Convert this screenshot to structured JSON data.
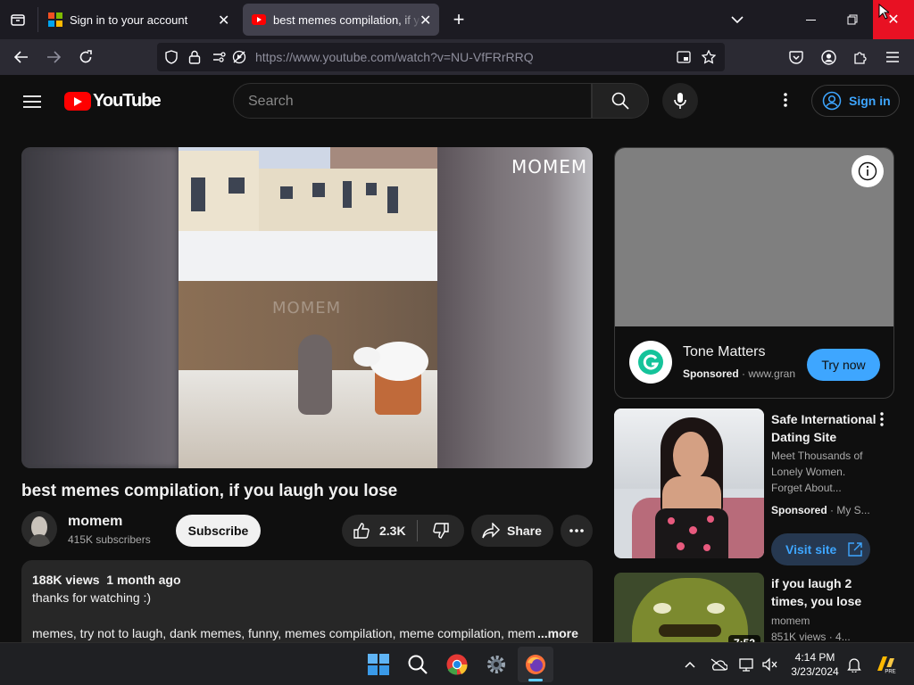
{
  "browser": {
    "tabs": [
      {
        "title": "Sign in to your account",
        "active": false
      },
      {
        "title": "best memes compilation, if you laugh you lose",
        "active": true
      }
    ],
    "url": "https://www.youtube.com/watch?v=NU-VfFRrRRQ"
  },
  "youtube": {
    "logo_text": "YouTube",
    "search_placeholder": "Search",
    "sign_in_label": "Sign in",
    "video": {
      "watermark": "MOMEM",
      "title": "best memes compilation, if you laugh you lose",
      "channel": "momem",
      "subscribers": "415K subscribers",
      "subscribe_label": "Subscribe",
      "likes": "2.3K",
      "share_label": "Share"
    },
    "description": {
      "views": "188K views",
      "age": "1 month ago",
      "line1": "thanks for watching :)",
      "tags": "memes, try not to laugh, dank memes, funny, memes compilation, meme compilation, mem",
      "more_label": "...more"
    },
    "ad_card": {
      "advertiser": "Tone Matters",
      "sponsored": "Sponsored",
      "domain": "www.gran",
      "cta": "Try now"
    },
    "sponsored_item": {
      "title_line1": "Safe International",
      "title_line2": "Dating Site",
      "desc_line1": "Meet Thousands of",
      "desc_line2": "Lonely Women.",
      "desc_line3": "Forget About...",
      "sponsored": "Sponsored",
      "by": "My S...",
      "cta": "Visit site"
    },
    "recommended": [
      {
        "title_line1": "if you laugh 2",
        "title_line2": "times, you lose",
        "channel": "momem",
        "meta": "851K views",
        "meta2": "4...",
        "duration": "7:53"
      }
    ]
  },
  "taskbar": {
    "time": "4:14 PM",
    "date": "3/23/2024"
  },
  "colors": {
    "accent_blue": "#3ea6ff",
    "youtube_red": "#ff0000",
    "close_red": "#e81123"
  }
}
